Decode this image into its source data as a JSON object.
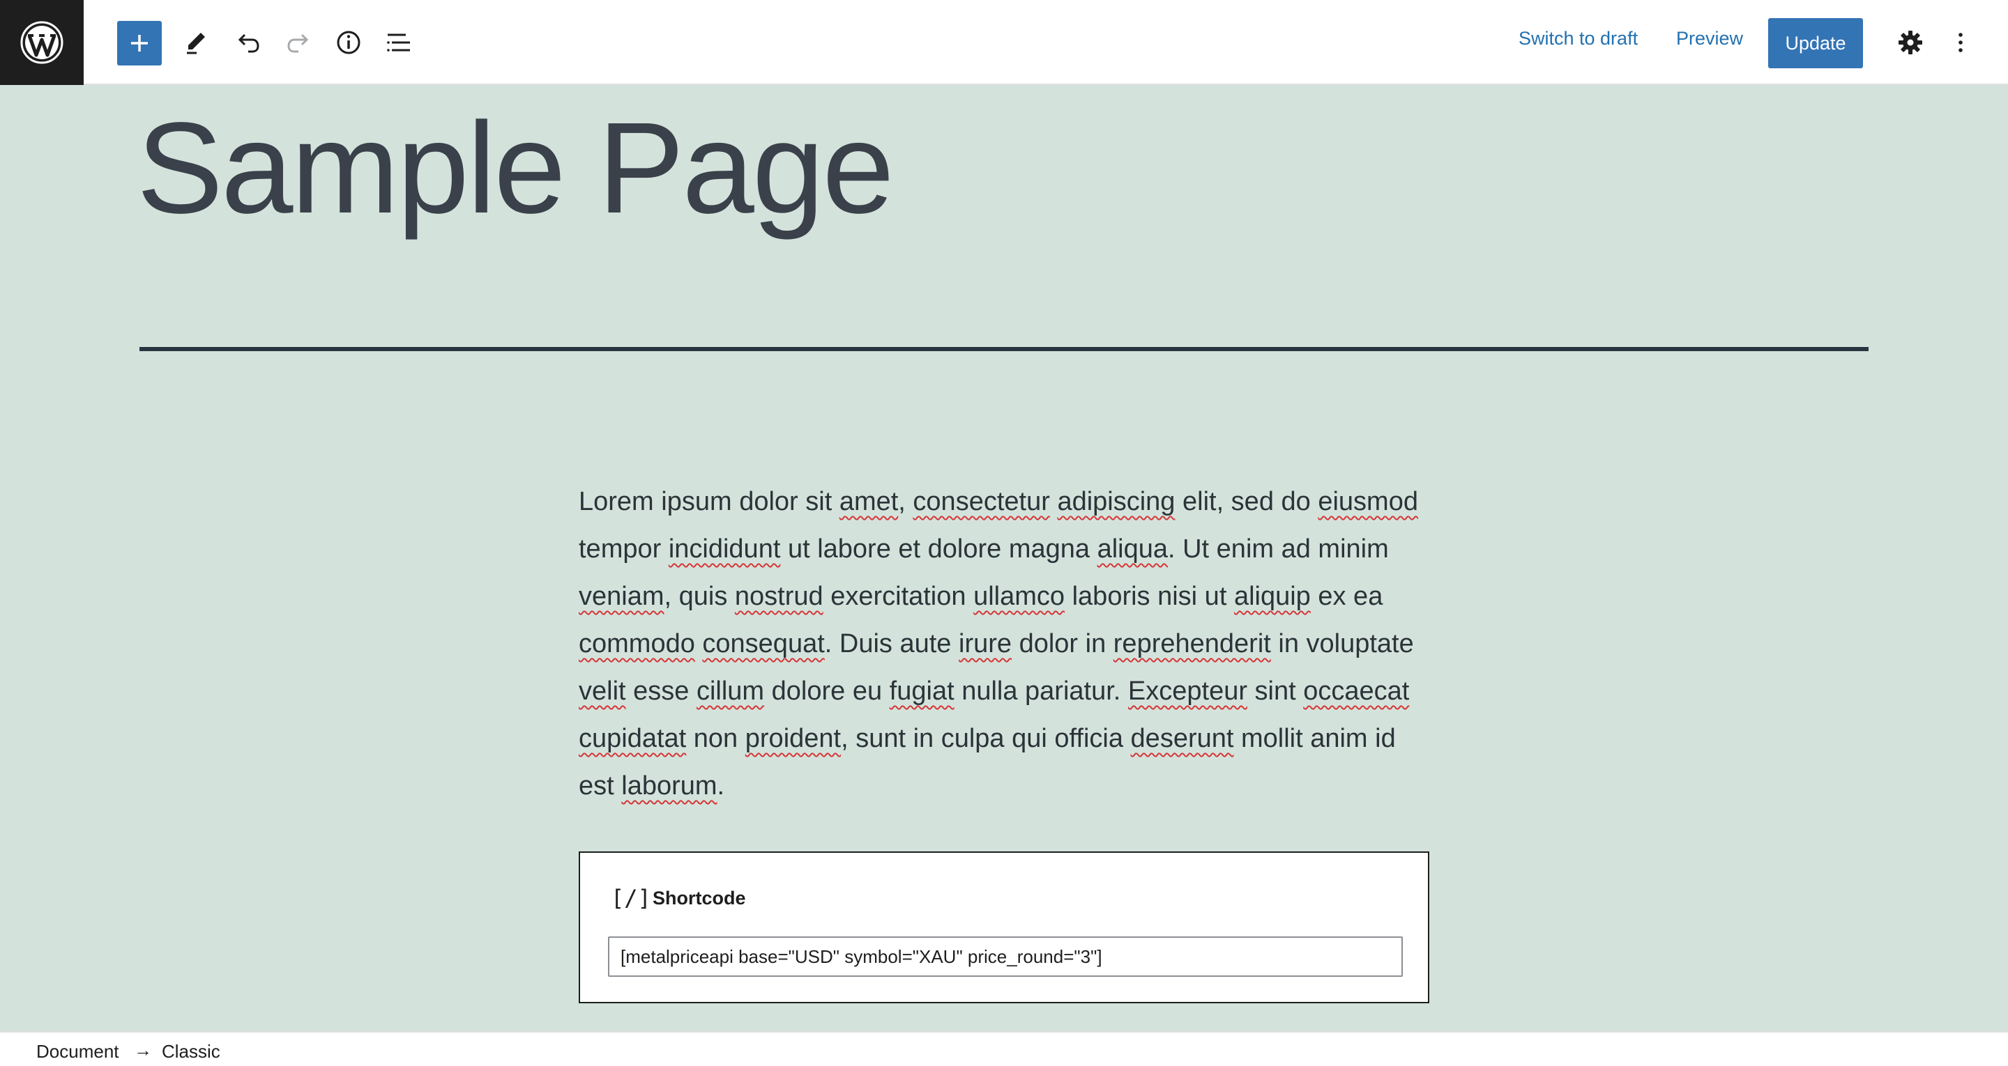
{
  "colors": {
    "accent": "#3374b5",
    "canvas": "#d3e3dc",
    "toolbar": "#ffffff",
    "logo_bg": "#1e1e1e",
    "text": "#2c3338"
  },
  "toolbar": {
    "icons": [
      "wordpress-logo",
      "plus-icon",
      "pencil-icon",
      "undo-icon",
      "redo-icon",
      "info-icon",
      "list-view-icon",
      "gear-icon",
      "more-vertical-icon"
    ],
    "switch_to_draft": "Switch to draft",
    "preview": "Preview",
    "update": "Update"
  },
  "page": {
    "title": "Sample Page",
    "paragraph_parts": [
      "Lorem ipsum dolor sit ",
      "amet",
      ", ",
      "consectetur",
      " ",
      "adipiscing",
      " elit, sed do ",
      "eiusmod",
      " tempor ",
      "incididunt",
      " ut labore et dolore magna ",
      "aliqua",
      ". Ut enim ad minim ",
      "veniam",
      ", quis ",
      "nostrud",
      " exercitation ",
      "ullamco",
      " laboris nisi ut ",
      "aliquip",
      " ex ea ",
      "commodo",
      " ",
      "consequat",
      ". Duis aute ",
      "irure",
      " dolor in ",
      "reprehenderit",
      " in voluptate ",
      "velit",
      " esse ",
      "cillum",
      " dolore eu ",
      "fugiat",
      " nulla pariatur. ",
      "Excepteur",
      " sint ",
      "occaecat",
      " ",
      "cupidatat",
      " non ",
      "proident",
      ", sunt in culpa qui officia ",
      "deserunt",
      " mollit anim id est ",
      "laborum",
      "."
    ]
  },
  "shortcode": {
    "icon_text": "[/]",
    "label": "Shortcode",
    "value": "[metalpriceapi base=\"USD\" symbol=\"XAU\" price_round=\"3\"]"
  },
  "breadcrumb": {
    "items": [
      "Document",
      "Classic"
    ],
    "separator": "→"
  }
}
